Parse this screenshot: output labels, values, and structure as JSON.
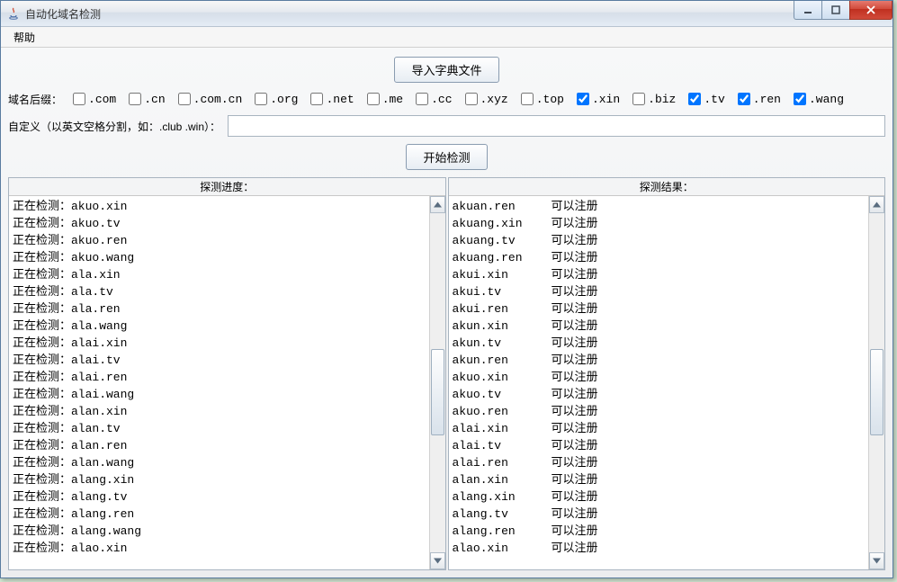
{
  "window": {
    "title": "自动化域名检测"
  },
  "menubar": {
    "help": "帮助"
  },
  "toolbar": {
    "import_btn": "导入字典文件",
    "start_btn": "开始检测"
  },
  "suffix_label": "域名后缀：",
  "suffixes": [
    {
      "label": ".com",
      "checked": false
    },
    {
      "label": ".cn",
      "checked": false
    },
    {
      "label": ".com.cn",
      "checked": false
    },
    {
      "label": ".org",
      "checked": false
    },
    {
      "label": ".net",
      "checked": false
    },
    {
      "label": ".me",
      "checked": false
    },
    {
      "label": ".cc",
      "checked": false
    },
    {
      "label": ".xyz",
      "checked": false
    },
    {
      "label": ".top",
      "checked": false
    },
    {
      "label": ".xin",
      "checked": true
    },
    {
      "label": ".biz",
      "checked": false
    },
    {
      "label": ".tv",
      "checked": true
    },
    {
      "label": ".ren",
      "checked": true
    },
    {
      "label": ".wang",
      "checked": true
    }
  ],
  "custom": {
    "label": "自定义（以英文空格分割，如：.club .win）：",
    "value": ""
  },
  "panels": {
    "progress_header": "探测进度：",
    "results_header": "探测结果："
  },
  "progress_prefix": "正在检测：",
  "progress_items": [
    "akuo.xin",
    "akuo.tv",
    "akuo.ren",
    "akuo.wang",
    "ala.xin",
    "ala.tv",
    "ala.ren",
    "ala.wang",
    "alai.xin",
    "alai.tv",
    "alai.ren",
    "alai.wang",
    "alan.xin",
    "alan.tv",
    "alan.ren",
    "alan.wang",
    "alang.xin",
    "alang.tv",
    "alang.ren",
    "alang.wang",
    "alao.xin"
  ],
  "result_status": "可以注册",
  "result_items": [
    "akuan.ren",
    "akuang.xin",
    "akuang.tv",
    "akuang.ren",
    "akui.xin",
    "akui.tv",
    "akui.ren",
    "akun.xin",
    "akun.tv",
    "akun.ren",
    "akuo.xin",
    "akuo.tv",
    "akuo.ren",
    "alai.xin",
    "alai.tv",
    "alai.ren",
    "alan.xin",
    "alang.xin",
    "alang.tv",
    "alang.ren",
    "alao.xin"
  ]
}
